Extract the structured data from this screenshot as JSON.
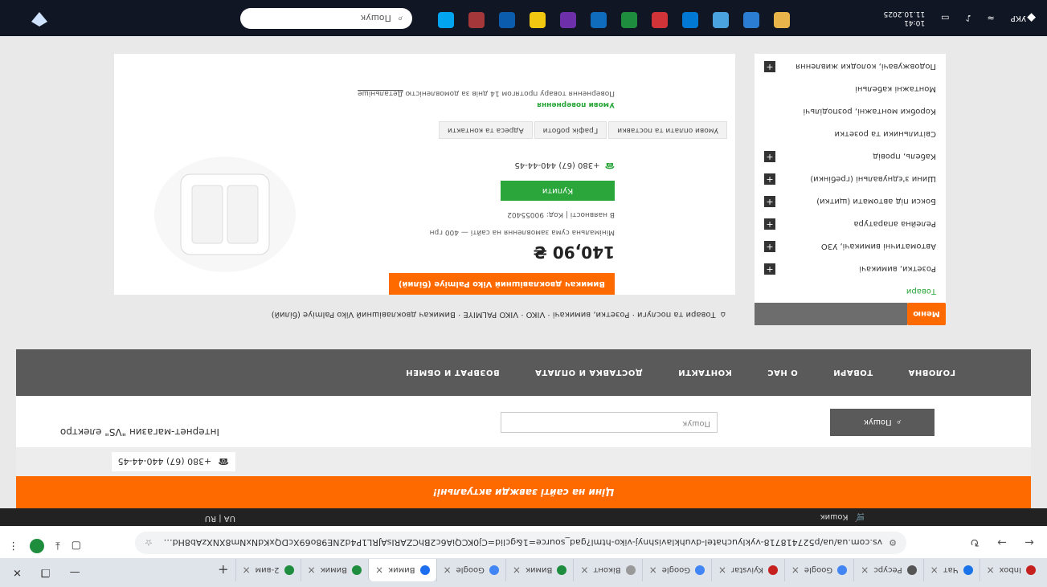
{
  "browser": {
    "tabs": [
      {
        "label": "Inbox",
        "color": "#c5221f"
      },
      {
        "label": "Чат",
        "color": "#1a73e8"
      },
      {
        "label": "Ресурс",
        "color": "#555555"
      },
      {
        "label": "Google",
        "color": "#4285f4"
      },
      {
        "label": "Kyivstar",
        "color": "#c5221f"
      },
      {
        "label": "Google",
        "color": "#4285f4"
      },
      {
        "label": "Віконт",
        "color": "#999999"
      },
      {
        "label": "Вимик",
        "color": "#1e8e3e"
      },
      {
        "label": "Google",
        "color": "#4285f4"
      },
      {
        "label": "Вимик",
        "color": "#1e6ff0"
      },
      {
        "label": "Вимик",
        "color": "#1e8e3e"
      },
      {
        "label": "2-вим",
        "color": "#1e8e3e"
      }
    ],
    "new_tab": "+",
    "url": "vs.com.ua/ua/p527418718-vyklyuchatel-dvuhklavishnyj-viko-html?gad_source=1&gclid=Cj0KCQiA6c2BhCZARIsAJRL1P4d2NE98o69XcDQxKdNxNm8XNXzAb8Hd9q8zvbtyrQkd0ee8"
  },
  "site": {
    "lang": "UA | RU",
    "cart_label": "Кошик",
    "promo": "Ціни на сайті завжди актуальні!",
    "phone": "+380 (67) 440-44-45",
    "shop_name": "Інтернет-магазин \"VS\" електро",
    "search_placeholder": "Пошук",
    "search_button": "Пошук",
    "nav": [
      "ГОЛОВНА",
      "ТОВАРИ",
      "О НАС",
      "КОНТАКТИ",
      "ДОСТАВКА И ОПЛАТА",
      "ВОЗВРАТ И ОБМЕН"
    ],
    "catalog_btn": "Меню",
    "breadcrumb": "Товари та послуги · Розетки, вимикачі · VIKO · VIKO PALMIYE · Вимикач двоклавішний Viko Palmiye (білий)",
    "sidebar": [
      {
        "label": "Товари",
        "plus": false,
        "active": true
      },
      {
        "label": "Розетки, вимикачі",
        "plus": true
      },
      {
        "label": "Автоматичні вимикачі, УЗО",
        "plus": true
      },
      {
        "label": "Релейна апаратура",
        "plus": true
      },
      {
        "label": "Бокси під автомати (щитки)",
        "plus": true
      },
      {
        "label": "Шини з'єднувальні (гребінки)",
        "plus": true
      },
      {
        "label": "Кабель, провід",
        "plus": true
      },
      {
        "label": "Світильники та розетки",
        "plus": false
      },
      {
        "label": "Коробки монтажні, розподільчі",
        "plus": false
      },
      {
        "label": "Монтажні кабельні",
        "plus": false
      },
      {
        "label": "Подовжувачі, колодки живлення",
        "plus": true
      }
    ],
    "product": {
      "badge": "Вимикач двоклавішний Viko Palmiye (білий)",
      "price": "140,90 ₴",
      "min_order": "Мінімальна сума замовлення на сайті — 400 грн",
      "availability": "В наявності | Код: 90055402",
      "buy": "Купити",
      "phone": "+380 (67) 440-44-45",
      "tabs": [
        "Умови оплати та поставки",
        "Графік роботи",
        "Адреса та контакти"
      ],
      "return_title": "Умови повернення",
      "return_text": "Повернення товару протягом 14 днів за домовленістю",
      "return_link": "Детальніше"
    }
  },
  "taskbar": {
    "search_placeholder": "Пошук",
    "apps": [
      "#e9b54a",
      "#2b7cd3",
      "#4aa3df",
      "#0078d4",
      "#d13438",
      "#1e8e3e",
      "#0f6cbd",
      "#6d2faa",
      "#f2c811",
      "#0b5cad",
      "#a4373a",
      "#00a4ef"
    ],
    "lang": "УКР",
    "time": "10:41",
    "date": "11.10.2025",
    "battery": "80%"
  }
}
